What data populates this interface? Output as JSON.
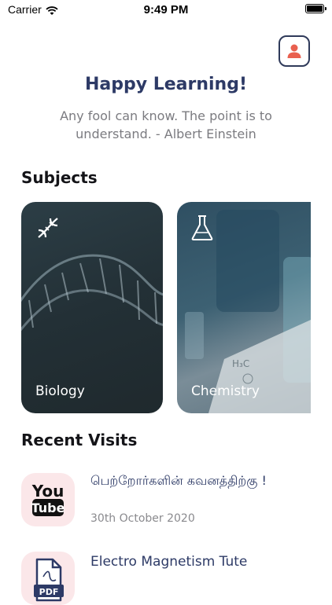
{
  "status_bar": {
    "carrier": "Carrier",
    "time": "9:49 PM"
  },
  "header": {
    "title": "Happy Learning!",
    "quote": "Any fool can know. The point is to understand. - Albert Einstein"
  },
  "subjects": {
    "section_title": "Subjects",
    "items": [
      {
        "label": "Biology",
        "icon": "dna-icon"
      },
      {
        "label": "Chemistry",
        "icon": "flask-icon"
      }
    ]
  },
  "recent": {
    "section_title": "Recent Visits",
    "items": [
      {
        "title": "பெற்றோர்களின் கவனத்திற்கு !",
        "date": "30th October 2020",
        "icon": "youtube-icon"
      },
      {
        "title": "Electro Magnetism Tute",
        "date": "",
        "icon": "pdf-icon"
      }
    ]
  },
  "colors": {
    "accent": "#e9604f",
    "heading": "#2d3a66",
    "thumb_bg": "#fbe7e9"
  }
}
